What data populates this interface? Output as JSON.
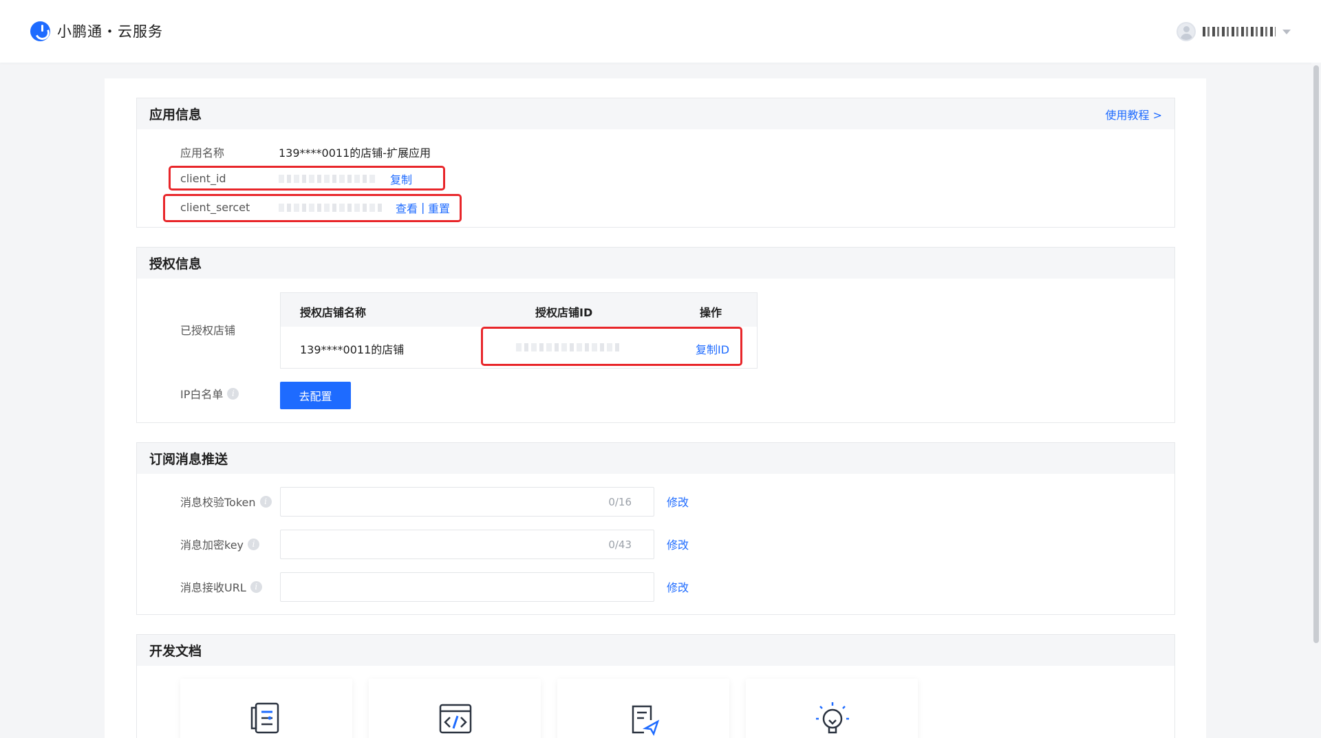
{
  "brand": {
    "name": "小鹏通・云服务"
  },
  "app_info": {
    "title": "应用信息",
    "tutorial_link": "使用教程 >",
    "app_name_label": "应用名称",
    "app_name_value": "139****0011的店铺-扩展应用",
    "client_id_label": "client_id",
    "client_id_action": "复制",
    "client_secret_label": "client_sercet",
    "client_secret_view": "查看",
    "client_secret_sep": "|",
    "client_secret_reset": "重置"
  },
  "auth_info": {
    "title": "授权信息",
    "authorized_shop_label": "已授权店铺",
    "columns": [
      "授权店铺名称",
      "授权店铺ID",
      "操作"
    ],
    "rows": [
      {
        "shop_name": "139****0011的店铺",
        "action": "复制ID"
      }
    ],
    "ip_whitelist_label": "IP白名单",
    "configure_button": "去配置"
  },
  "subscription": {
    "title": "订阅消息推送",
    "fields": [
      {
        "label": "消息校验Token",
        "value": "",
        "counter": "0/16",
        "action": "修改"
      },
      {
        "label": "消息加密key",
        "value": "",
        "counter": "0/43",
        "action": "修改"
      },
      {
        "label": "消息接收URL",
        "value": "",
        "counter": "",
        "action": "修改"
      }
    ]
  },
  "dev_docs": {
    "title": "开发文档",
    "cards": [
      {
        "icon": "api-list-icon"
      },
      {
        "icon": "code-icon"
      },
      {
        "icon": "document-send-icon"
      },
      {
        "icon": "lightbulb-icon"
      }
    ]
  },
  "colors": {
    "primary": "#1e6bff",
    "highlight": "#e8262a",
    "section_head_bg": "#f5f6f8"
  }
}
